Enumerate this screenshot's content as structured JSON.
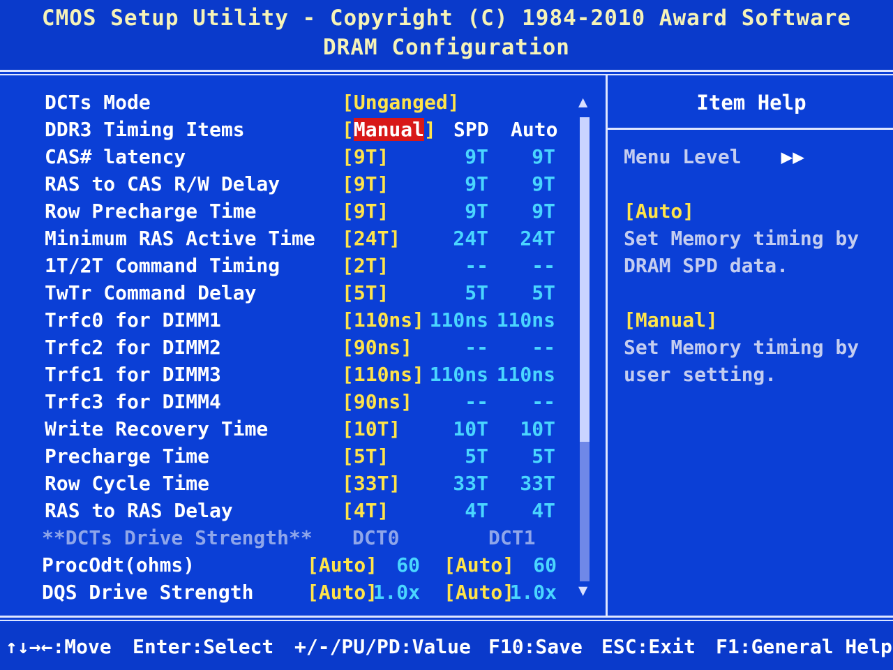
{
  "header": {
    "title": "CMOS Setup Utility - Copyright (C) 1984-2010 Award Software",
    "subtitle": "DRAM Configuration"
  },
  "columns": {
    "spd": "SPD",
    "auto": "Auto"
  },
  "settings": [
    {
      "label": "DCTs Mode",
      "value": "[Unganged]",
      "spd": "",
      "auto": ""
    },
    {
      "label": "DDR3 Timing Items",
      "value_open": "[",
      "value_hl": "Manual",
      "value_close": "]",
      "spd": "",
      "auto": ""
    },
    {
      "label": "CAS# latency",
      "value": "[9T]",
      "spd": "9T",
      "auto": "9T"
    },
    {
      "label": "RAS to CAS R/W Delay",
      "value": "[9T]",
      "spd": "9T",
      "auto": "9T"
    },
    {
      "label": "Row Precharge Time",
      "value": "[9T]",
      "spd": "9T",
      "auto": "9T"
    },
    {
      "label": "Minimum RAS Active Time",
      "value": "[24T]",
      "spd": "24T",
      "auto": "24T"
    },
    {
      "label": "1T/2T Command Timing",
      "value": "[2T]",
      "spd": "--",
      "auto": "--"
    },
    {
      "label": "TwTr Command Delay",
      "value": "[5T]",
      "spd": "5T",
      "auto": "5T"
    },
    {
      "label": "Trfc0 for DIMM1",
      "value": "[110ns]",
      "spd": "110ns",
      "auto": "110ns"
    },
    {
      "label": "Trfc2 for DIMM2",
      "value": "[90ns]",
      "spd": "--",
      "auto": "--"
    },
    {
      "label": "Trfc1 for DIMM3",
      "value": "[110ns]",
      "spd": "110ns",
      "auto": "110ns"
    },
    {
      "label": "Trfc3 for DIMM4",
      "value": "[90ns]",
      "spd": "--",
      "auto": "--"
    },
    {
      "label": "Write Recovery Time",
      "value": "[10T]",
      "spd": "10T",
      "auto": "10T"
    },
    {
      "label": "Precharge Time",
      "value": "[5T]",
      "spd": "5T",
      "auto": "5T"
    },
    {
      "label": "Row Cycle Time",
      "value": "[33T]",
      "spd": "33T",
      "auto": "33T"
    },
    {
      "label": "RAS to RAS Delay",
      "value": "[4T]",
      "spd": "4T",
      "auto": "4T"
    }
  ],
  "drive_strength": {
    "section_label": "**DCTs Drive Strength**",
    "dct0": "DCT0",
    "dct1": "DCT1",
    "rows": [
      {
        "label": "ProcOdt(ohms)",
        "v0": "[Auto]",
        "d0": "60",
        "v1": "[Auto]",
        "d1": "60"
      },
      {
        "label": "DQS Drive Strength",
        "v0": "[Auto]",
        "d0": "1.0x",
        "v1": "[Auto]",
        "d1": "1.0x"
      }
    ]
  },
  "help": {
    "title": "Item Help",
    "menu_level": "Menu Level",
    "menu_level_glyph": "▶▶",
    "auto_key": "[Auto]",
    "auto_line1": "Set Memory timing by",
    "auto_line2": "DRAM SPD data.",
    "manual_key": "[Manual]",
    "manual_line1": "Set Memory timing by",
    "manual_line2": "user setting."
  },
  "footer": {
    "move": "↑↓→←:Move",
    "select": "Enter:Select",
    "value": "+/-/PU/PD:Value",
    "save": "F10:Save",
    "exit": "ESC:Exit",
    "help": "F1:General Help"
  },
  "colors": {
    "background": "#0b3fd6",
    "value": "#ffe44a",
    "default": "#4ad6ff",
    "highlight": "#d81818"
  }
}
